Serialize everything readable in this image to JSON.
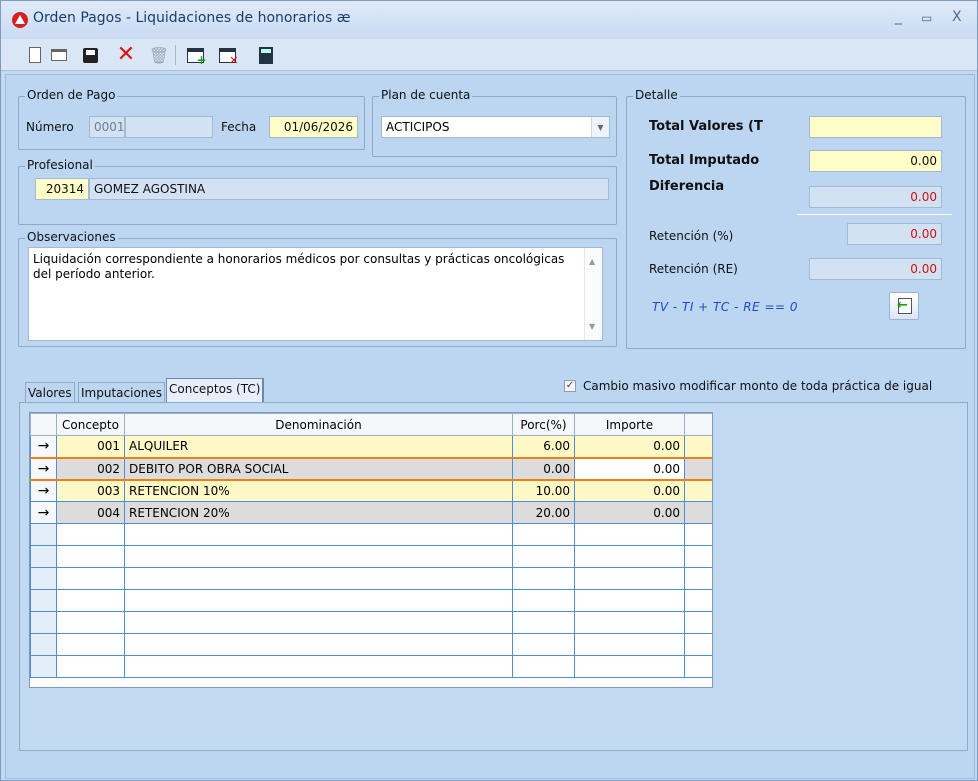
{
  "window": {
    "title": "Orden Pagos - Liquidaciones de honorarios æ",
    "controls": {
      "minimize": "_",
      "maximize": "▭",
      "close": "X"
    }
  },
  "toolbar": {
    "icons": [
      "new-document-icon",
      "open-folder-icon",
      "save-icon",
      "delete-icon",
      "trash-icon",
      "add-calendar-icon",
      "remove-calendar-icon",
      "calculator-icon"
    ]
  },
  "orden_pago": {
    "legend": "Orden de Pago",
    "numero_label": "Número",
    "numero_value": "0001",
    "numero_extra": "",
    "fecha_label": "Fecha",
    "fecha_value": "01/06/2026"
  },
  "plan_cuenta": {
    "legend": "Plan de cuenta",
    "selected": "ACTICIPOS"
  },
  "profesional": {
    "legend": "Profesional",
    "code": "20314",
    "name": "GOMEZ AGOSTINA"
  },
  "observaciones": {
    "legend": "Observaciones",
    "text": "Liquidación correspondiente a honorarios médicos por consultas y prácticas oncológicas del período anterior."
  },
  "detalle": {
    "legend": "Detalle",
    "total_valores_label": "Total Valores (T",
    "total_valores_value": "",
    "total_imputado_label": "Total Imputado",
    "total_imputado_value": "0.00",
    "diferencia_label": "Diferencia",
    "diferencia_value": "0.00",
    "retencion_pct_label": "Retención (%)",
    "retencion_pct_value": "0.00",
    "retencion_re_label": "Retención (RE)",
    "retencion_re_value": "0.00",
    "formula": "TV - TI + TC - RE == 0"
  },
  "tabs": [
    {
      "label": "Valores"
    },
    {
      "label": "Imputaciones"
    },
    {
      "label": "Conceptos (TC)"
    }
  ],
  "cambio_masivo": {
    "checked": true,
    "label": "Cambio masivo modificar monto de toda práctica de igual"
  },
  "grid": {
    "columns": [
      "Concepto",
      "Denominación",
      "Porc(%)",
      "Importe"
    ],
    "rows": [
      {
        "indicator": "→",
        "concepto": "001",
        "denominacion": "ALQUILER",
        "porc": "6.00",
        "importe": "0.00"
      },
      {
        "indicator": "→",
        "concepto": "002",
        "denominacion": "DEBITO POR OBRA SOCIAL",
        "porc": "0.00",
        "importe": "0.00"
      },
      {
        "indicator": "→",
        "concepto": "003",
        "denominacion": "RETENCION 10%",
        "porc": "10.00",
        "importe": "0.00"
      },
      {
        "indicator": "→",
        "concepto": "004",
        "denominacion": "RETENCION 20%",
        "porc": "20.00",
        "importe": "0.00"
      }
    ]
  }
}
